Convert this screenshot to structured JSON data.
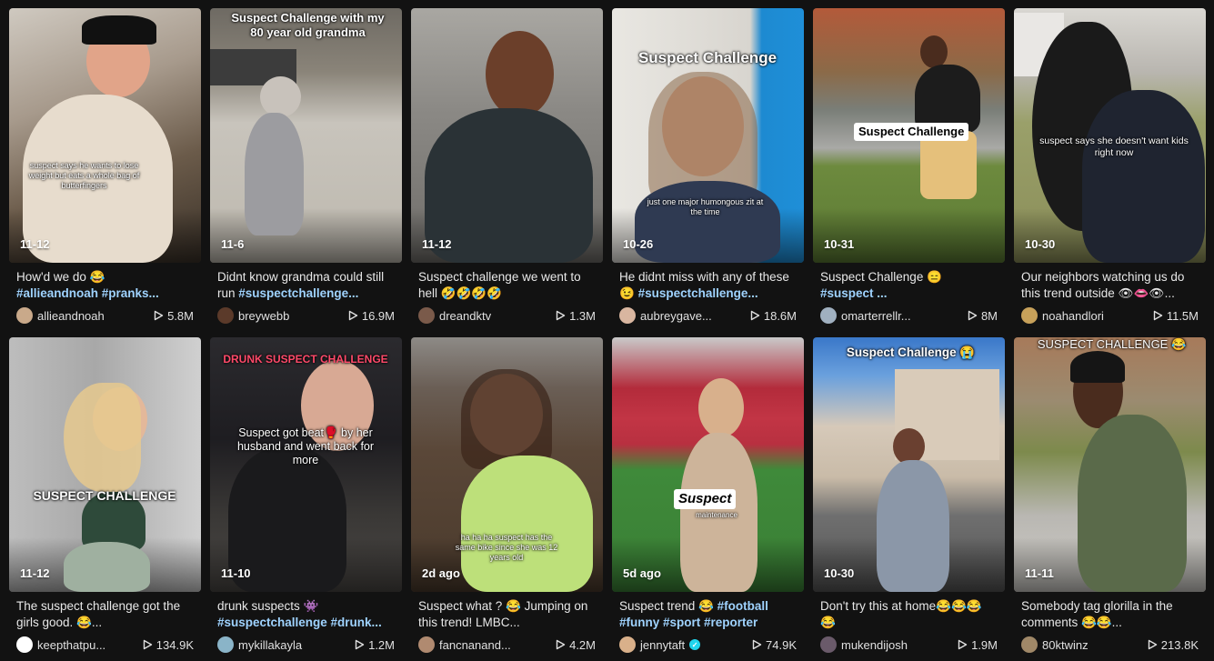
{
  "colors": {
    "background": "#121212",
    "hashtag": "#9fd3ff",
    "text": "#e8e8e8"
  },
  "videos": [
    {
      "date": "11-12",
      "overlay": "suspect says he wants to lose weight but eats a whole bag of butterfingers",
      "desc_text": "How'd we do 😂",
      "desc_tags": "#allieandnoah #pranks...",
      "author": "allieandnoah",
      "views": "5.8M"
    },
    {
      "date": "11-6",
      "overlay": "Suspect Challenge with my 80 year old grandma",
      "desc_text": "Didnt know grandma could still run",
      "desc_tags": "#suspectchallenge...",
      "author": "breywebb",
      "views": "16.9M"
    },
    {
      "date": "11-12",
      "overlay": "",
      "desc_text": "Suspect challenge we went to hell 🤣🤣🤣🤣",
      "desc_tags": "",
      "author": "dreandktv",
      "views": "1.3M"
    },
    {
      "date": "10-26",
      "overlay": "Suspect Challenge",
      "overlay2": "just one major humongous zit at the time",
      "desc_text": "He didnt miss with any of these 😉",
      "desc_tags": "#suspectchallenge...",
      "author": "aubreygave...",
      "views": "18.6M"
    },
    {
      "date": "10-31",
      "overlay": "Suspect Challenge",
      "desc_text": "Suspect Challenge 😑",
      "desc_tags": "#suspect ...",
      "author": "omarterrellr...",
      "views": "8M"
    },
    {
      "date": "10-30",
      "overlay": "suspect says she doesn't want kids right now",
      "desc_text": "Our neighbors watching us do this trend outside 👁👄👁...",
      "desc_tags": "",
      "author": "noahandlori",
      "views": "11.5M"
    },
    {
      "date": "11-12",
      "overlay": "SUSPECT CHALLENGE",
      "desc_text": "The suspect challenge got the girls good. 😂...",
      "desc_tags": "",
      "author": "keepthatpu...",
      "views": "134.9K"
    },
    {
      "date": "11-10",
      "overlay": "DRUNK SUSPECT CHALLENGE",
      "overlay2": "Suspect got beat🥊 by her husband and went back for more",
      "desc_text": "drunk suspects 👾",
      "desc_tags": "#suspectchallenge #drunk...",
      "author": "mykillakayla",
      "views": "1.2M"
    },
    {
      "date": "2d ago",
      "overlay": "ha ha ha suspect has the same bike since she was 12 years old",
      "desc_text": "Suspect what ? 😂 Jumping on this trend! LMBC...",
      "desc_tags": "",
      "author": "fancnanand...",
      "views": "4.2M"
    },
    {
      "date": "5d ago",
      "overlay": "Suspect",
      "overlay2": "maintenance",
      "desc_text": "Suspect trend 😂",
      "desc_tags": "#football #funny #sport #reporter",
      "author": "jennytaft",
      "verified": true,
      "views": "74.9K"
    },
    {
      "date": "10-30",
      "overlay": "Suspect Challenge 😭",
      "desc_text": "Don't try this at home😂😂😂 😂",
      "desc_tags": "",
      "author": "mukendijosh",
      "views": "1.9M"
    },
    {
      "date": "11-11",
      "overlay": "SUSPECT CHALLENGE 😂",
      "desc_text": "Somebody tag glorilla in the comments 😂😂...",
      "desc_tags": "",
      "author": "80ktwinz",
      "views": "213.8K"
    }
  ]
}
